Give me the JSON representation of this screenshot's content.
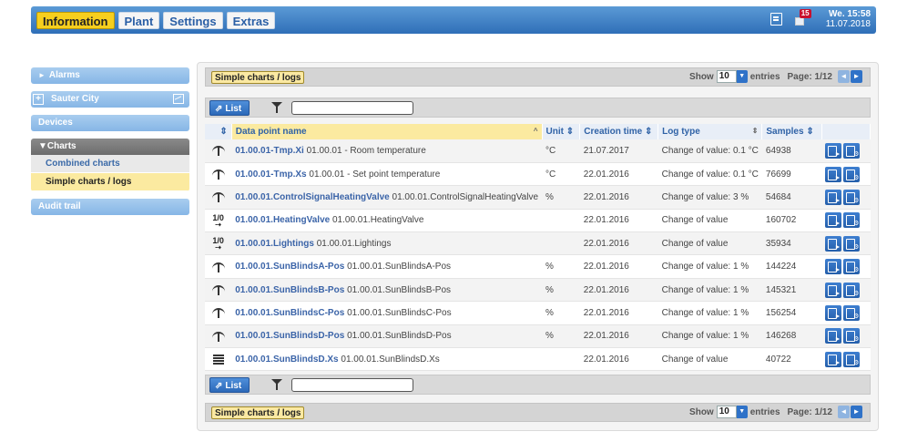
{
  "nav": {
    "tabs": [
      "Information",
      "Plant",
      "Settings",
      "Extras"
    ],
    "alarm_count": "15",
    "datetime_line1": "We. 15:58",
    "datetime_line2": "11.07.2018"
  },
  "sidebar": {
    "alarms": "Alarms",
    "alarms_marker": "►",
    "sauter_city": "Sauter City",
    "sauter_city_marker": "+",
    "devices": "Devices",
    "charts": "Charts",
    "charts_marker": "▼",
    "charts_items": [
      "Combined charts",
      "Simple charts / logs"
    ],
    "audit_trail": "Audit trail"
  },
  "panel": {
    "title": "Simple charts / logs",
    "show_label": "Show",
    "entries_value": "10",
    "entries_label": "entries",
    "page_label": "Page: 1/12",
    "list_button": "List",
    "filter_value": ""
  },
  "table": {
    "headers": [
      "Data point name",
      "Unit",
      "Creation time",
      "Log type",
      "Samples"
    ],
    "sort_indicator_active": "^",
    "sort_indicator": "⇕",
    "rows": [
      {
        "type_icon": "analog-value-icon",
        "code": "01.00.01-Tmp.Xi",
        "desc": "01.00.01 - Room temperature",
        "unit": "°C",
        "created": "21.07.2017",
        "logtype": "Change of value: 0.1 °C",
        "samples": "64938"
      },
      {
        "type_icon": "analog-value-icon",
        "code": "01.00.01-Tmp.Xs",
        "desc": "01.00.01 - Set point temperature",
        "unit": "°C",
        "created": "22.01.2016",
        "logtype": "Change of value: 0.1 °C",
        "samples": "76699"
      },
      {
        "type_icon": "analog-value-icon",
        "code": "01.00.01.ControlSignalHeatingValve",
        "desc": "01.00.01.ControlSignalHeatingValve",
        "unit": "%",
        "created": "22.01.2016",
        "logtype": "Change of value: 3 %",
        "samples": "54684"
      },
      {
        "type_icon": "binary-value-icon",
        "code": "01.00.01.HeatingValve",
        "desc": "01.00.01.HeatingValve",
        "unit": "",
        "created": "22.01.2016",
        "logtype": "Change of value",
        "samples": "160702"
      },
      {
        "type_icon": "binary-value-icon",
        "code": "01.00.01.Lightings",
        "desc": "01.00.01.Lightings",
        "unit": "",
        "created": "22.01.2016",
        "logtype": "Change of value",
        "samples": "35934"
      },
      {
        "type_icon": "analog-value-icon",
        "code": "01.00.01.SunBlindsA-Pos",
        "desc": "01.00.01.SunBlindsA-Pos",
        "unit": "%",
        "created": "22.01.2016",
        "logtype": "Change of value: 1 %",
        "samples": "144224"
      },
      {
        "type_icon": "analog-value-icon",
        "code": "01.00.01.SunBlindsB-Pos",
        "desc": "01.00.01.SunBlindsB-Pos",
        "unit": "%",
        "created": "22.01.2016",
        "logtype": "Change of value: 1 %",
        "samples": "145321"
      },
      {
        "type_icon": "analog-value-icon",
        "code": "01.00.01.SunBlindsC-Pos",
        "desc": "01.00.01.SunBlindsC-Pos",
        "unit": "%",
        "created": "22.01.2016",
        "logtype": "Change of value: 1 %",
        "samples": "156254"
      },
      {
        "type_icon": "analog-value-icon",
        "code": "01.00.01.SunBlindsD-Pos",
        "desc": "01.00.01.SunBlindsD-Pos",
        "unit": "%",
        "created": "22.01.2016",
        "logtype": "Change of value: 1 %",
        "samples": "146268"
      },
      {
        "type_icon": "multistate-value-icon",
        "code": "01.00.01.SunBlindsD.Xs",
        "desc": "01.00.01.SunBlindsD.Xs",
        "unit": "",
        "created": "22.01.2016",
        "logtype": "Change of value",
        "samples": "40722"
      }
    ]
  },
  "colors": {
    "active_tab": "#f6cf1e",
    "topbar": "#2f6fb8",
    "link": "#3b64a8",
    "highlight": "#fbeaa0"
  }
}
